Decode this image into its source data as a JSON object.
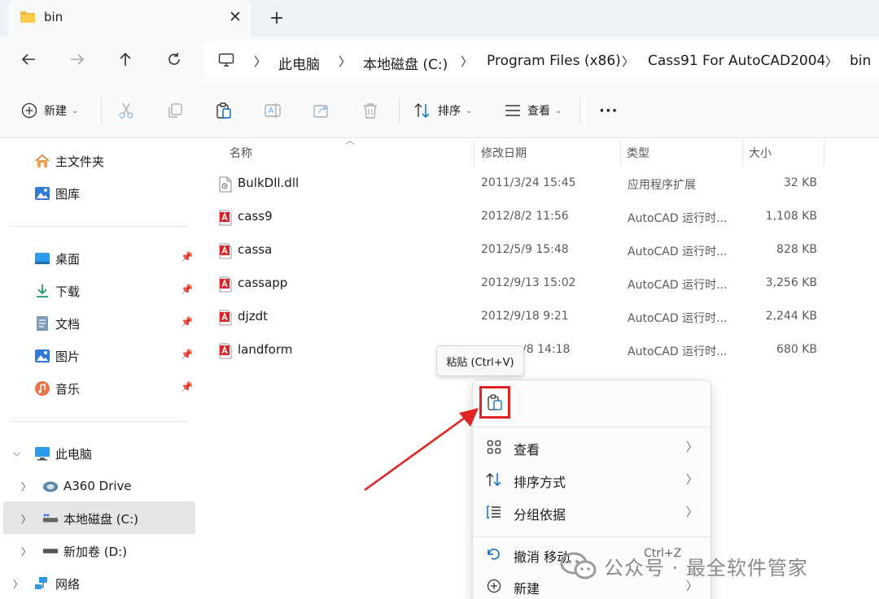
{
  "tab": {
    "title": "bin",
    "close": "✕",
    "new": "+"
  },
  "breadcrumb": [
    {
      "label": "此电脑"
    },
    {
      "label": "本地磁盘 (C:)"
    },
    {
      "label": "Program Files (x86)"
    },
    {
      "label": "Cass91 For AutoCAD2004"
    },
    {
      "label": "bin"
    }
  ],
  "toolbar": {
    "new_label": "新建",
    "sort_label": "排序",
    "view_label": "查看",
    "more_label": "···"
  },
  "sidebar": {
    "top": [
      {
        "label": "主文件夹",
        "icon": "home-icon"
      },
      {
        "label": "图库",
        "icon": "gallery-icon"
      }
    ],
    "pinned": [
      {
        "label": "桌面",
        "icon": "desktop-icon"
      },
      {
        "label": "下载",
        "icon": "download-icon"
      },
      {
        "label": "文档",
        "icon": "document-icon"
      },
      {
        "label": "图片",
        "icon": "pictures-icon"
      },
      {
        "label": "音乐",
        "icon": "music-icon"
      }
    ],
    "tree": [
      {
        "label": "此电脑",
        "icon": "this-pc-icon"
      },
      {
        "label": "A360 Drive",
        "icon": "cloud-drive-icon"
      },
      {
        "label": "本地磁盘 (C:)",
        "icon": "disk-icon",
        "selected": true
      },
      {
        "label": "新加卷 (D:)",
        "icon": "disk-icon"
      },
      {
        "label": "网络",
        "icon": "network-icon"
      }
    ]
  },
  "columns": {
    "name": "名称",
    "date": "修改日期",
    "type": "类型",
    "size": "大小"
  },
  "files": [
    {
      "name": "BulkDll.dll",
      "date": "2011/3/24 15:45",
      "type": "应用程序扩展",
      "size": "32 KB",
      "icon": "dll-file-icon"
    },
    {
      "name": "cass9",
      "date": "2012/8/2 11:56",
      "type": "AutoCAD 运行时...",
      "size": "1,108 KB",
      "icon": "autocad-file-icon"
    },
    {
      "name": "cassa",
      "date": "2012/5/9 15:48",
      "type": "AutoCAD 运行时...",
      "size": "828 KB",
      "icon": "autocad-file-icon"
    },
    {
      "name": "cassapp",
      "date": "2012/9/13 15:02",
      "type": "AutoCAD 运行时...",
      "size": "3,256 KB",
      "icon": "autocad-file-icon"
    },
    {
      "name": "djzdt",
      "date": "2012/9/18 9:21",
      "type": "AutoCAD 运行时...",
      "size": "2,244 KB",
      "icon": "autocad-file-icon"
    },
    {
      "name": "landform",
      "date": "/8 14:18",
      "type": "AutoCAD 运行时...",
      "size": "680 KB",
      "icon": "autocad-file-icon"
    }
  ],
  "tooltip": "粘贴 (Ctrl+V)",
  "context_menu": {
    "items": [
      {
        "label": "查看",
        "icon": "grid-icon",
        "chevron": "〉"
      },
      {
        "label": "排序方式",
        "icon": "sort-icon",
        "chevron": "〉"
      },
      {
        "label": "分组依据",
        "icon": "group-icon",
        "chevron": "〉"
      },
      {
        "label": "撤消 移动",
        "icon": "undo-icon",
        "shortcut": "Ctrl+Z"
      },
      {
        "label": "新建",
        "icon": "new-icon",
        "chevron": "〉"
      }
    ]
  },
  "watermark": "公众号 · 最全软件管家",
  "colors": {
    "accent": "#0067c0",
    "highlight": "#e02424",
    "chrome": "#eef1f6"
  }
}
